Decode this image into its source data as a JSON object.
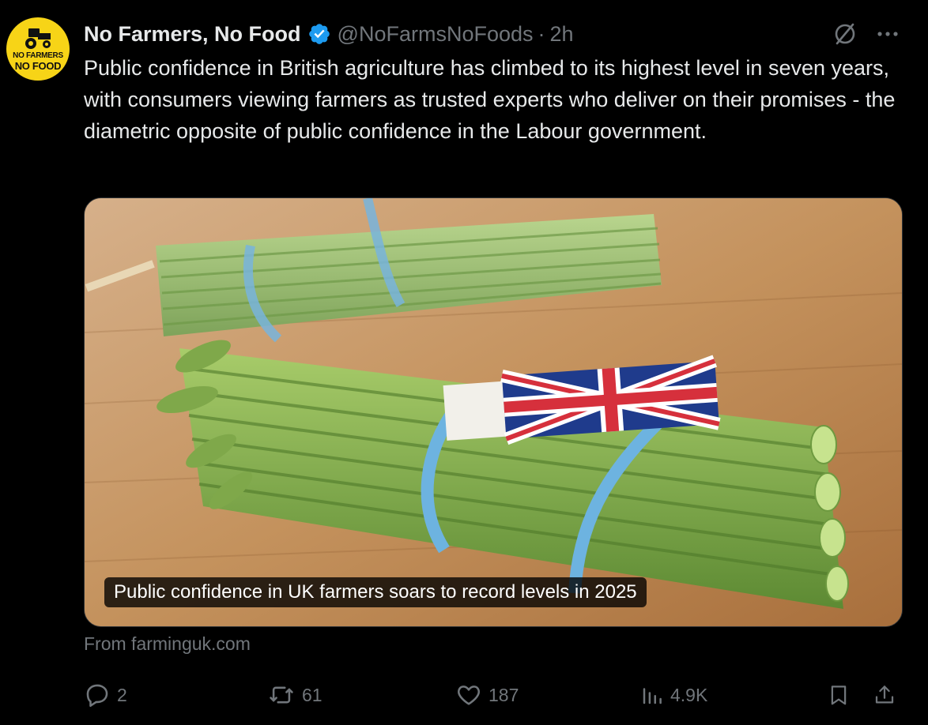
{
  "avatar": {
    "line1": "NO FARMERS",
    "line2": "NO FOOD"
  },
  "author": {
    "display_name": "No Farmers, No Food",
    "handle": "@NoFarmsNoFoods",
    "separator": "·",
    "time": "2h"
  },
  "tweet": {
    "text": "Public confidence in British agriculture has climbed to its highest level in seven years, with consumers viewing farmers as trusted experts who deliver on their promises - the diametric opposite of public confidence in the Labour government."
  },
  "card": {
    "caption": "Public confidence in UK farmers soars to record levels in 2025",
    "source": "From farminguk.com",
    "image": "asparagus bundles tied with blue rubber bands and a Union Jack label on a wooden board"
  },
  "actions": {
    "replies": "2",
    "reposts": "61",
    "likes": "187",
    "views": "4.9K"
  },
  "colors": {
    "background": "#000000",
    "text": "#e7e9ea",
    "secondary": "#71767b",
    "verified": "#1d9bf0",
    "avatar_bg": "#f7d417"
  },
  "icons": [
    "verified-badge-icon",
    "grok-icon",
    "more-icon",
    "reply-icon",
    "repost-icon",
    "like-icon",
    "views-icon",
    "bookmark-icon",
    "share-icon"
  ]
}
